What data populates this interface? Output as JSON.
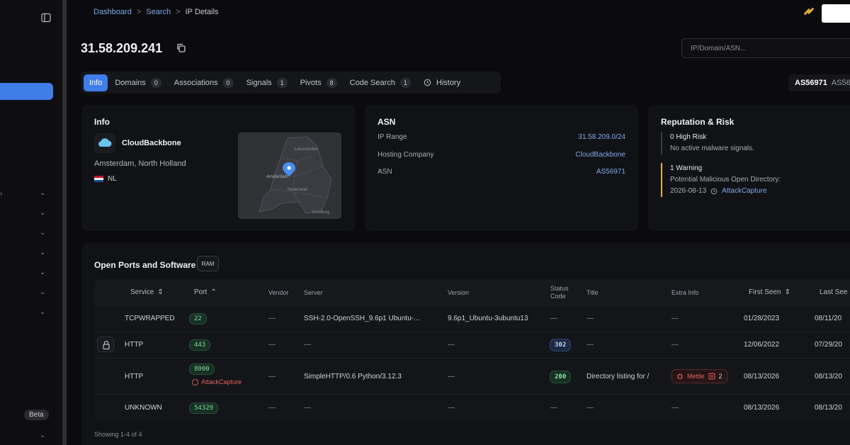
{
  "breadcrumb": {
    "items": [
      "Dashboard",
      "Search",
      "IP Details"
    ],
    "separator": ">"
  },
  "page": {
    "title": "31.58.209.241"
  },
  "search": {
    "placeholder": "IP/Domain/ASN..."
  },
  "tabs": [
    {
      "label": "Info",
      "count": null,
      "active": true
    },
    {
      "label": "Domains",
      "count": "0"
    },
    {
      "label": "Associations",
      "count": "0"
    },
    {
      "label": "Signals",
      "count": "1"
    },
    {
      "label": "Pivots",
      "count": "8"
    },
    {
      "label": "Code Search",
      "count": "1"
    },
    {
      "label": "History",
      "count": null,
      "icon": "history-icon"
    }
  ],
  "as_badge": {
    "primary": "AS56971",
    "secondary": "AS56"
  },
  "info": {
    "title": "Info",
    "provider": "CloudBackbone",
    "location": "Amsterdam, North Holland",
    "country": "NL",
    "map_labels": {
      "city": "Amsterdam",
      "region1": "Leeuwarden",
      "region2": "Nederland",
      "region3": "Duisburg"
    }
  },
  "asn": {
    "title": "ASN",
    "rows": [
      {
        "label": "IP Range",
        "value": "31.58.209.0/24"
      },
      {
        "label": "Hosting Company",
        "value": "CloudBackbone"
      },
      {
        "label": "ASN",
        "value": "AS56971"
      }
    ]
  },
  "reputation": {
    "title": "Reputation & Risk",
    "high_risk": {
      "headline": "0 High Risk",
      "detail": "No active malware signals."
    },
    "warning": {
      "headline": "1 Warning",
      "detail": "Potential Malicious Open Directory:",
      "date": "2026-08-13",
      "source": "AttackCapture"
    }
  },
  "ports": {
    "title": "Open Ports and Software",
    "badge": "RAM",
    "columns": {
      "service": "Service",
      "port": "Port",
      "vendor": "Vendor",
      "server": "Server",
      "version": "Version",
      "status_1": "Status",
      "status_2": "Code",
      "title": "Title",
      "extra": "Extra Info",
      "first_seen": "First Seen",
      "last_seen": "Last See"
    },
    "rows": [
      {
        "service": "TCPWRAPPED",
        "port": "22",
        "vendor": "—",
        "server": "SSH-2.0-OpenSSH_9.6p1 Ubuntu-...",
        "version": "9.6p1_Ubuntu-3ubuntu13",
        "status": "—",
        "title": "—",
        "extra": "—",
        "first_seen": "01/28/2023",
        "last_seen": "08/11/20"
      },
      {
        "service": "HTTP",
        "port": "443",
        "vendor": "—",
        "server": "—",
        "version": "—",
        "status": "302",
        "title": "—",
        "extra": "—",
        "first_seen": "12/06/2022",
        "last_seen": "07/29/20"
      },
      {
        "service": "HTTP",
        "port": "8000",
        "port_tag": "AttackCapture",
        "vendor": "—",
        "server": "SimpleHTTP/0.6 Python/3.12.3",
        "version": "—",
        "status": "200",
        "title": "Directory listing for /",
        "extra_tag": "Mettle",
        "extra_count": "2",
        "first_seen": "08/13/2026",
        "last_seen": "08/13/20"
      },
      {
        "service": "UNKNOWN",
        "port": "54329",
        "vendor": "—",
        "server": "—",
        "version": "—",
        "status": "—",
        "title": "—",
        "extra": "—",
        "first_seen": "08/13/2026",
        "last_seen": "08/13/20"
      }
    ],
    "footer": "Showing 1-4 of 4"
  },
  "sidebar": {
    "beta_label": "Beta"
  },
  "colors": {
    "accent": "#3f7de8",
    "link": "#7fa8e8",
    "warning": "#e3b14a",
    "danger": "#e2605b",
    "success": "#7fd9a0"
  }
}
